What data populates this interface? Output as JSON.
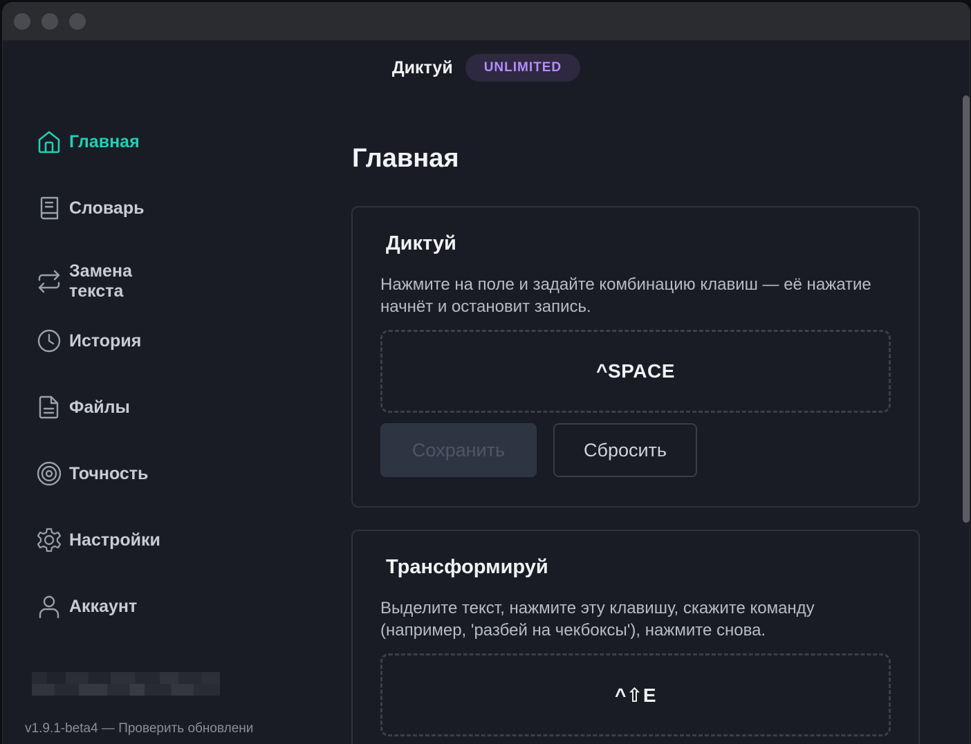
{
  "header": {
    "title": "Диктуй",
    "badge": "UNLIMITED"
  },
  "sidebar": {
    "items": [
      {
        "label": "Главная",
        "icon": "home-icon",
        "active": true
      },
      {
        "label": "Словарь",
        "icon": "book-icon",
        "active": false
      },
      {
        "label": "Замена текста",
        "icon": "swap-arrows-icon",
        "active": false
      },
      {
        "label": "История",
        "icon": "clock-icon",
        "active": false
      },
      {
        "label": "Файлы",
        "icon": "file-icon",
        "active": false
      },
      {
        "label": "Точность",
        "icon": "target-icon",
        "active": false
      },
      {
        "label": "Настройки",
        "icon": "gear-icon",
        "active": false
      },
      {
        "label": "Аккаунт",
        "icon": "user-icon",
        "active": false
      }
    ],
    "version": "v1.9.1-beta4 — Проверить обновлени"
  },
  "main": {
    "page_title": "Главная",
    "cards": [
      {
        "title": "Диктуй",
        "description": "Нажмите на поле и задайте комбинацию клавиш — её нажатие начнёт и остановит запись.",
        "hotkey": "^SPACE",
        "save_label": "Сохранить",
        "reset_label": "Сбросить"
      },
      {
        "title": "Трансформируй",
        "description": "Выделите текст, нажмите эту клавишу, скажите команду (например, 'разбей на чекбоксы'), нажмите снова.",
        "hotkey": "^⇧E"
      }
    ]
  },
  "colors": {
    "accent": "#1fd1b4",
    "badge_text": "#b88cff",
    "background": "#1a1c25"
  }
}
